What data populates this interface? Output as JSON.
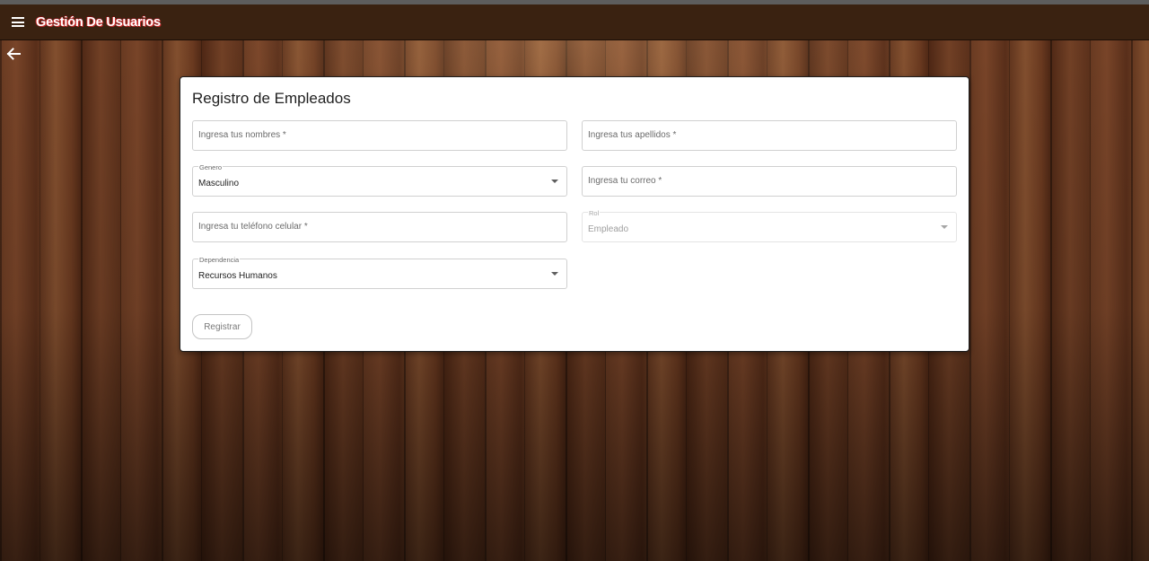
{
  "appbar": {
    "title": "Gestión De Usuarios",
    "menu_icon": "menu-icon",
    "back_icon": "arrow-left-icon"
  },
  "form": {
    "title": "Registro de Empleados",
    "fields": {
      "nombres": {
        "placeholder": "Ingresa tus nombres *"
      },
      "apellidos": {
        "placeholder": "Ingresa tus apellidos *"
      },
      "genero": {
        "label": "Genero",
        "value": "Masculino"
      },
      "correo": {
        "placeholder": "Ingresa tu correo *"
      },
      "telefono": {
        "placeholder": "Ingresa tu teléfono celular *"
      },
      "rol": {
        "label": "Rol",
        "value": "Empleado"
      },
      "dependencia": {
        "label": "Dependencia",
        "value": "Recursos Humanos"
      }
    },
    "submit_label": "Registrar"
  },
  "colors": {
    "appbar": "#3a2211",
    "title_shadow": "#c62828",
    "card": "#ffffff"
  }
}
